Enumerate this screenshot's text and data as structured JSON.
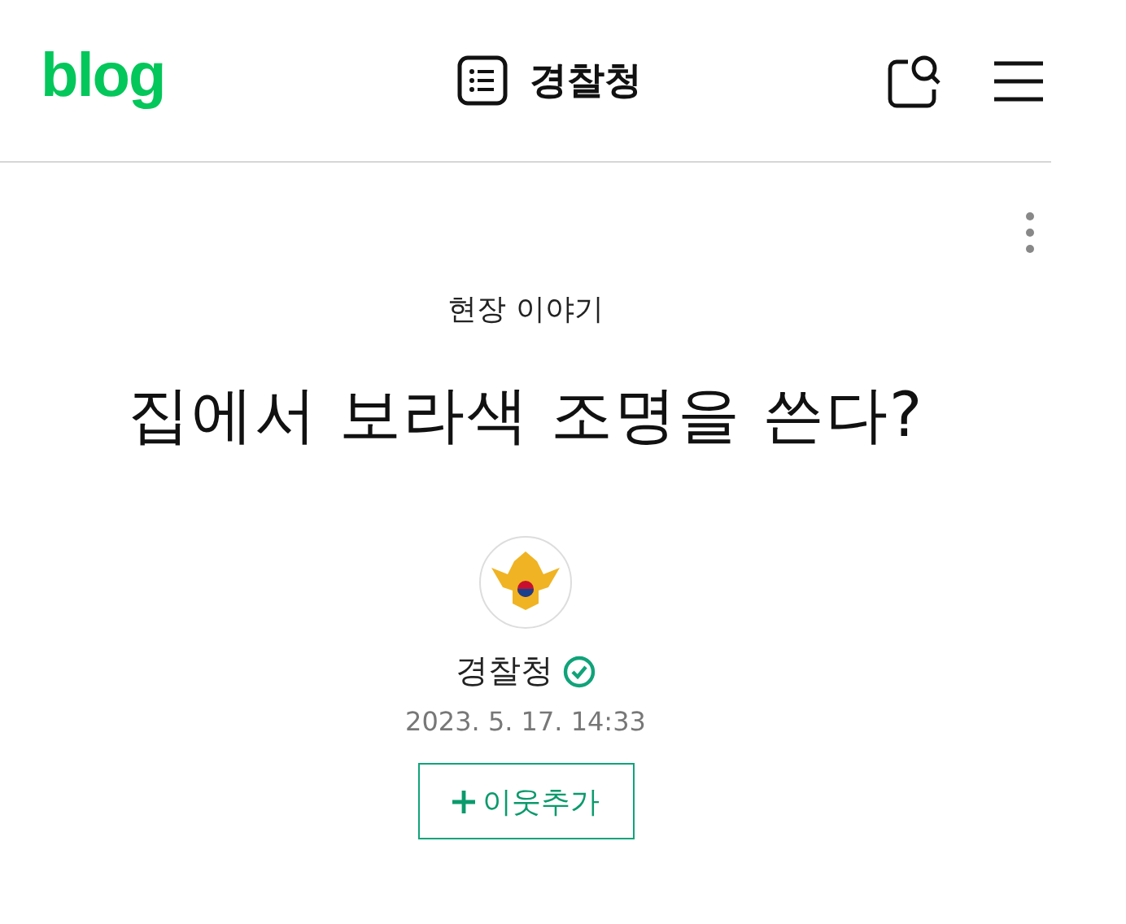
{
  "header": {
    "logo": "blog",
    "blog_title": "경찰청"
  },
  "post": {
    "category": "현장 이야기",
    "title": "집에서 보라색 조명을 쓴다?",
    "author": {
      "name": "경찰청",
      "verified": true
    },
    "date": "2023. 5. 17. 14:33",
    "follow_button": "이웃추가"
  }
}
